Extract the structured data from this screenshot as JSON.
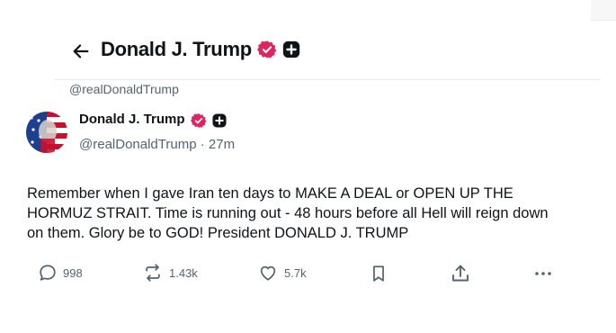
{
  "header": {
    "title": "Donald J. Trump",
    "handle": "@realDonaldTrump"
  },
  "post": {
    "author_name": "Donald J. Trump",
    "author_handle": "@realDonaldTrump",
    "separator": "·",
    "time_ago": "27m",
    "text": "Remember when I gave Iran ten days to MAKE A DEAL or OPEN UP THE HORMUZ STRAIT. Time is running out - 48 hours before all Hell will reign down on them. Glory be to GOD! President DONALD J. TRUMP"
  },
  "actions": {
    "replies": "998",
    "reposts": "1.43k",
    "likes": "5.7k"
  },
  "icons": {
    "back": "arrow-left-icon",
    "verified": "verified-badge-icon",
    "plus": "plus-badge-icon",
    "reply": "comment-bubble-icon",
    "repost": "repost-icon",
    "like": "heart-icon",
    "bookmark": "bookmark-icon",
    "share": "share-upload-icon",
    "more": "ellipsis-icon"
  },
  "colors": {
    "verified": "#e0245e",
    "secondary_text": "#536471",
    "text": "#0f1419"
  }
}
